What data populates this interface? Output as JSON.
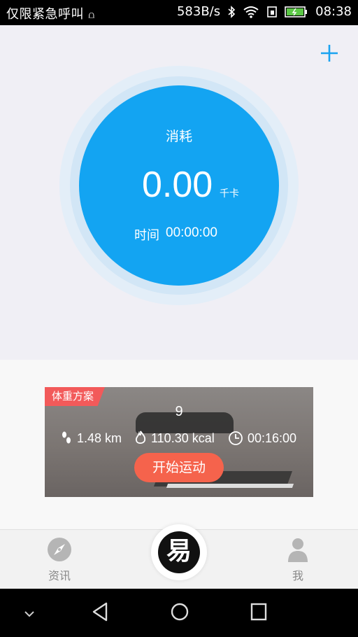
{
  "status_bar": {
    "carrier": "仅限紧急呼叫",
    "speed": "583B/s",
    "time": "08:38"
  },
  "summary": {
    "consume_label": "消耗",
    "calorie_value": "0.00",
    "calorie_unit": "千卡",
    "time_label": "时间",
    "time_value": "00:00:00"
  },
  "plan_card": {
    "tag": "体重方案",
    "index": "9",
    "distance": "1.48 km",
    "calories": "110.30 kcal",
    "duration": "00:16:00",
    "start_label": "开始运动"
  },
  "tab_bar": {
    "news_label": "资讯",
    "center_logo": "易",
    "me_label": "我"
  },
  "colors": {
    "accent": "#13a4f2",
    "start_button": "#f5634c",
    "plan_tag": "#f25a5a"
  },
  "icons": [
    "bluetooth-icon",
    "wifi-icon",
    "battery-icon",
    "plus-icon",
    "footsteps-icon",
    "fire-icon",
    "clock-icon",
    "compass-icon",
    "person-icon",
    "back-icon",
    "home-icon",
    "recents-icon"
  ]
}
